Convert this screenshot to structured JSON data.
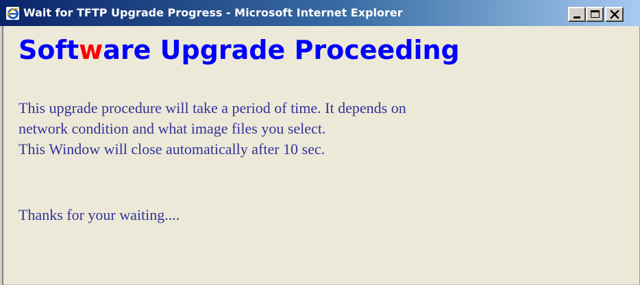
{
  "window": {
    "title": "Wait for TFTP Upgrade Progress - Microsoft Internet Explorer",
    "app_icon": "internet-explorer-icon",
    "buttons": {
      "minimize": "minimize-icon",
      "maximize": "maximize-icon",
      "close": "close-icon"
    }
  },
  "heading": {
    "part1": "Soft",
    "accent": "w",
    "part2": "are Upgrade Proceeding"
  },
  "body": {
    "lines": [
      "This upgrade procedure will take a period of time. It depends on",
      "network condition and what image files you select.",
      "This Window will close automatically after 10 sec."
    ],
    "thanks": "Thanks for your waiting...."
  },
  "colors": {
    "heading": "#0000ff",
    "heading_accent": "#ff0000",
    "body_text": "#333399",
    "background": "#ece9d8",
    "titlebar_start": "#0a246a",
    "titlebar_end": "#a6caf0"
  }
}
